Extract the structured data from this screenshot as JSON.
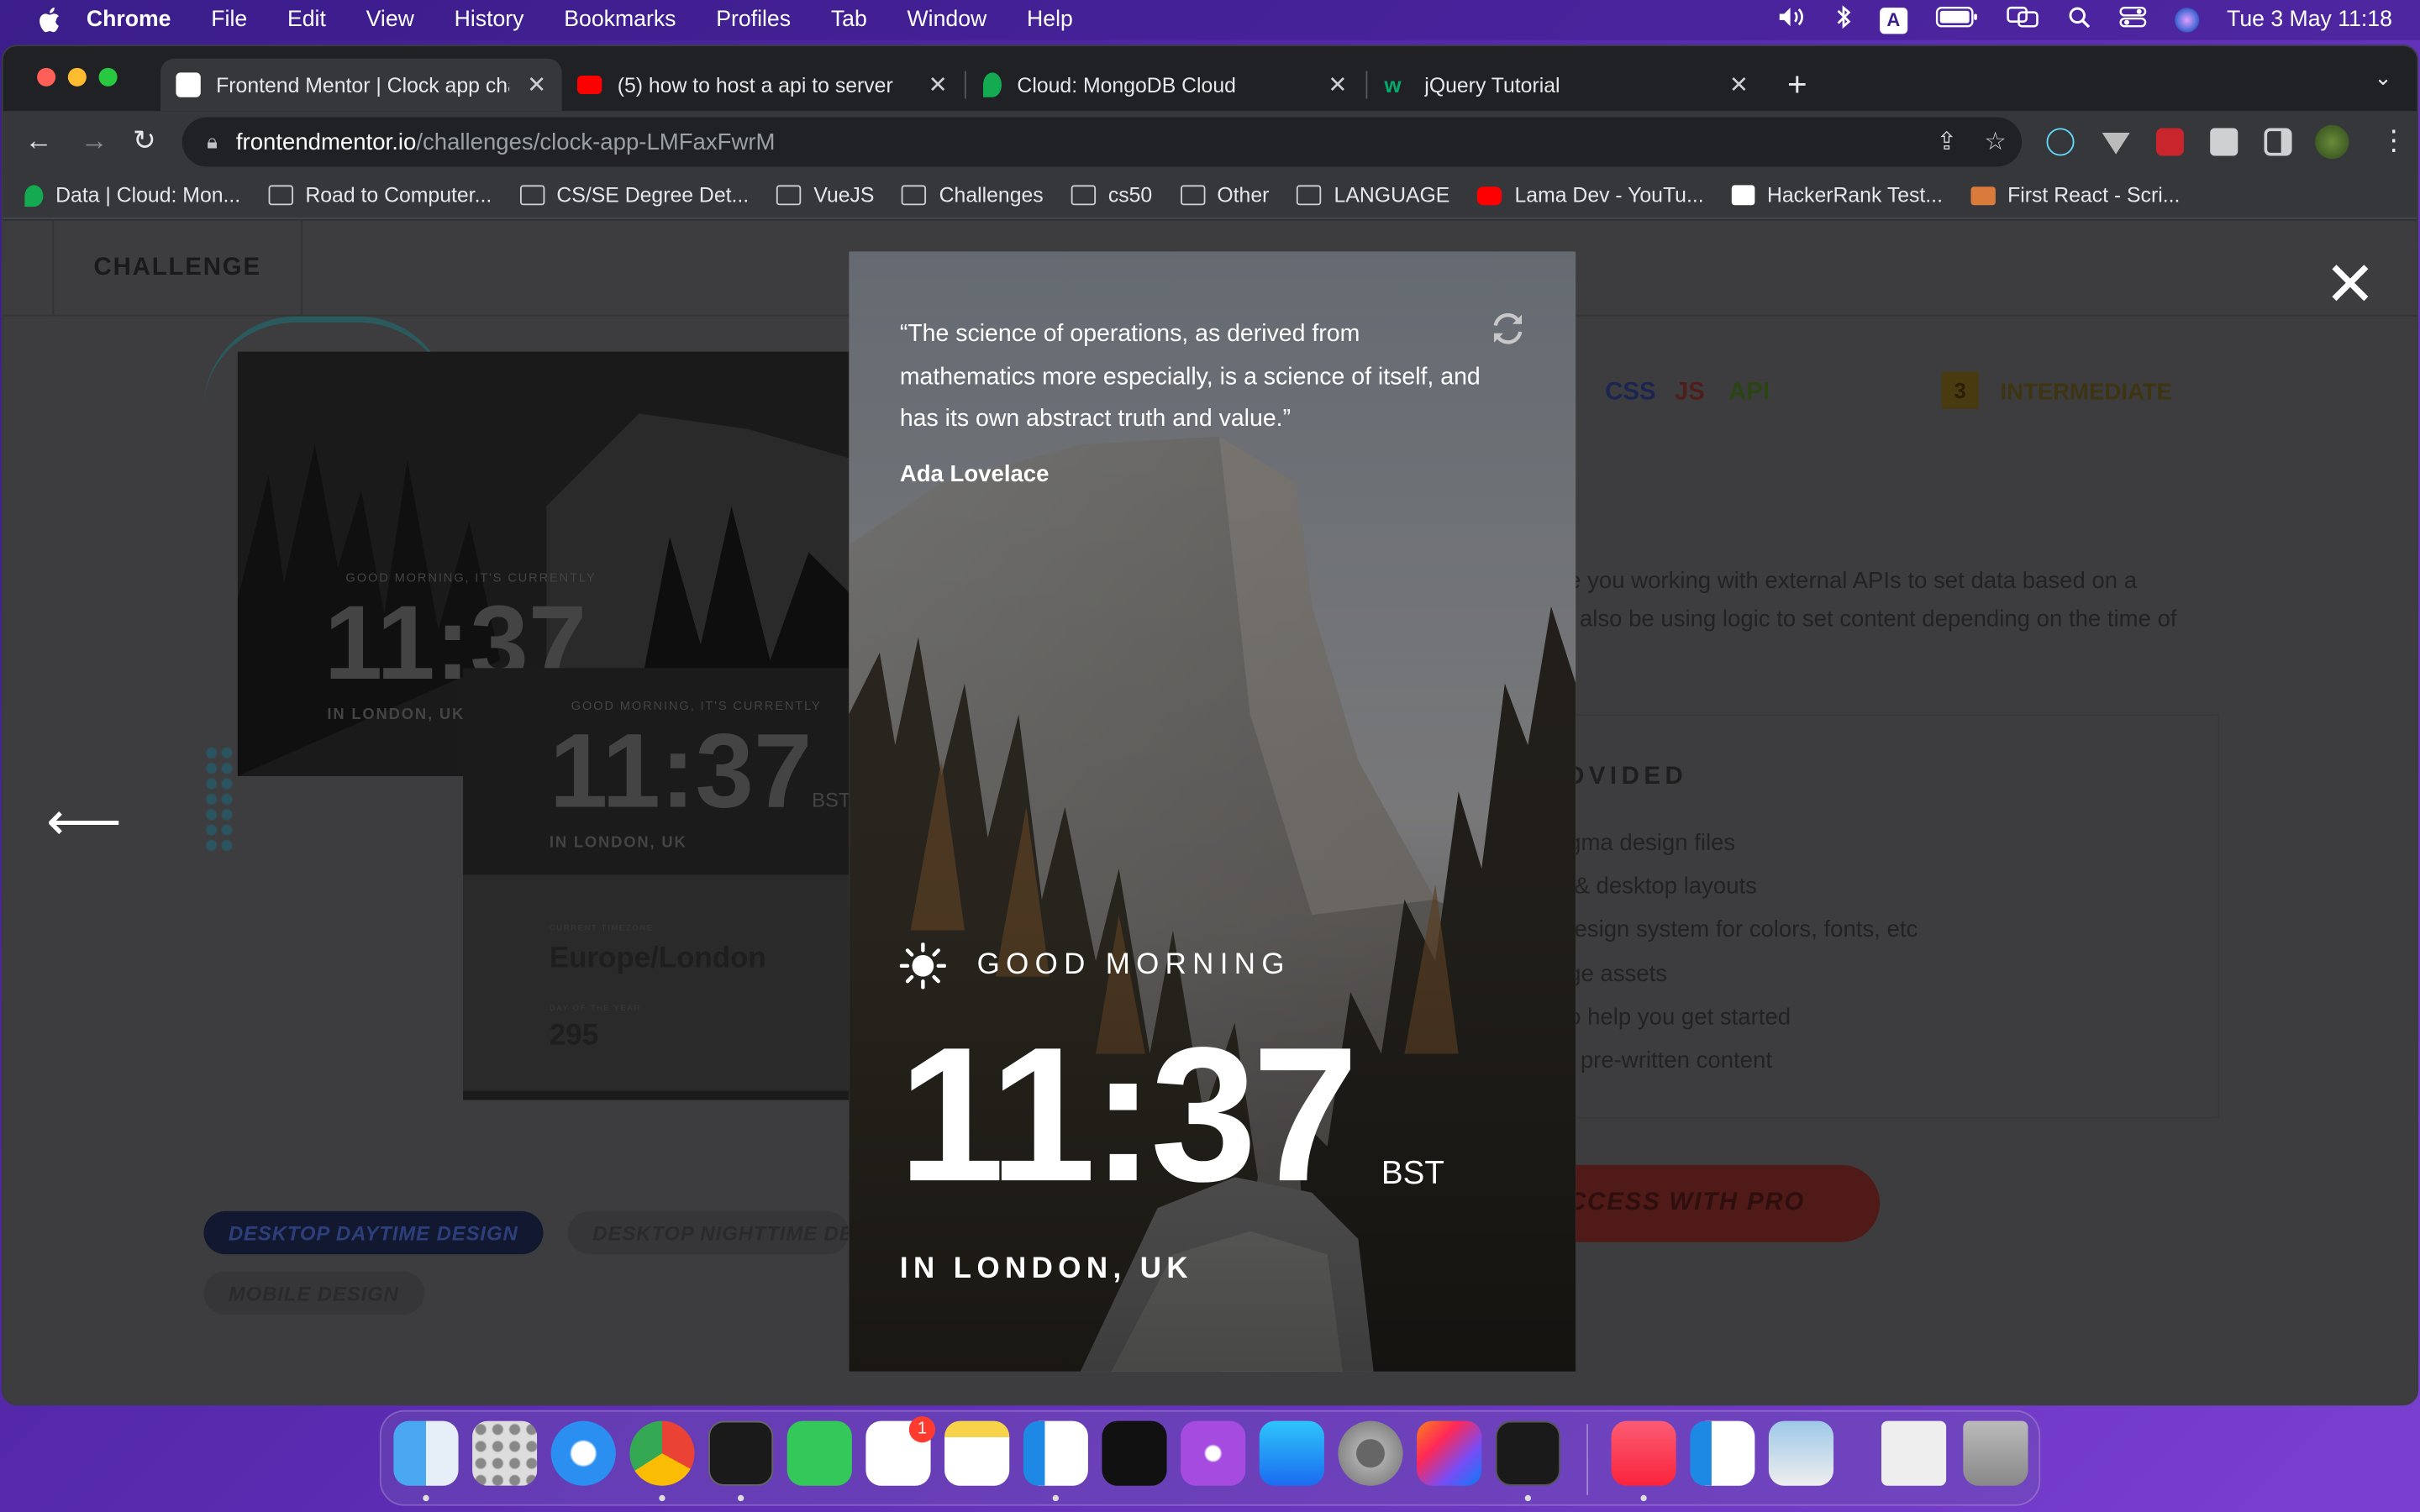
{
  "menubar": {
    "app": "Chrome",
    "items": [
      "File",
      "Edit",
      "View",
      "History",
      "Bookmarks",
      "Profiles",
      "Tab",
      "Window",
      "Help"
    ],
    "input_source": "A",
    "datetime": "Tue 3 May  11:18"
  },
  "tabs": [
    {
      "title": "Frontend Mentor | Clock app challenge",
      "active": true
    },
    {
      "title": "(5) how to host a api to server"
    },
    {
      "title": "Cloud: MongoDB Cloud"
    },
    {
      "title": "jQuery Tutorial"
    }
  ],
  "address": {
    "host": "frontendmentor.io",
    "path": "/challenges/clock-app-LMFaxFwrM"
  },
  "bookmarks": [
    "Data | Cloud: Mon...",
    "Road to Computer...",
    "CS/SE Degree Det...",
    "VueJS",
    "Challenges",
    "cs50",
    "Other",
    "LANGUAGE",
    "Lama Dev - YouTu...",
    "HackerRank Test...",
    "First React - Scri..."
  ],
  "page": {
    "challenge_label": "CHALLENGE",
    "tags": [
      "CSS",
      "JS",
      "API"
    ],
    "level_number": "3",
    "level_label": "INTERMEDIATE",
    "desc_line1": "e you working with external APIs to set data based on a",
    "desc_line2": "l also be using logic to set content depending on the time of",
    "provided_heading": "OVIDED",
    "provided_items": [
      "gma design files",
      "& desktop layouts",
      "esign system for colors, fonts, etc",
      "ge assets",
      "o help you get started",
      "pre-written content"
    ],
    "pro_button": "CCESS WITH PRO",
    "pills": [
      "DESKTOP DAYTIME DESIGN",
      "DESKTOP NIGHTTIME DE",
      "MOBILE DESIGN"
    ],
    "thumb": {
      "greeting": "GOOD MORNING, IT'S CURRENTLY",
      "time": "11:37",
      "tz": "BST",
      "location": "IN LONDON, UK",
      "timezone_label": "CURRENT TIMEZONE",
      "timezone": "Europe/London",
      "day_label": "DAY OF THE YEAR",
      "day": "295"
    }
  },
  "modal": {
    "quote": "“The science of operations, as derived from mathematics more especially, is a science of itself, and has its own abstract truth and value.”",
    "author": "Ada Lovelace",
    "greeting": "GOOD MORNING",
    "time": "11:37",
    "tz": "BST",
    "location": "IN LONDON, UK"
  },
  "dock": {
    "reminders_badge": "1"
  },
  "colors": {
    "accent_red": "#d94a3d",
    "pill_blue": "#1b2b6b",
    "css": "#4a6ad8",
    "js": "#c8554a",
    "api": "#6fae2e"
  }
}
